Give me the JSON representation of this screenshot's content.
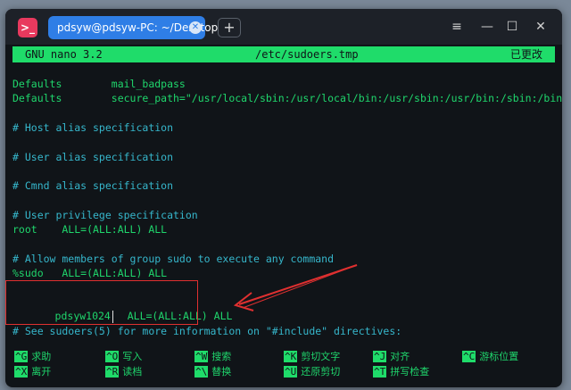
{
  "titlebar": {
    "tab_title": "pdsyw@pdsyw-PC: ~/Desktop",
    "tab_close": "✕",
    "new_tab": "+",
    "menu_icon": "≡",
    "minimize": "—",
    "maximize": "☐",
    "close": "✕"
  },
  "nano_header": {
    "version": "GNU nano 3.2",
    "filename": "/etc/sudoers.tmp",
    "status": "已更改"
  },
  "lines": [
    {
      "text": "Defaults        mail_badpass",
      "type": "normal"
    },
    {
      "text": "Defaults        secure_path=\"/usr/local/sbin:/usr/local/bin:/usr/sbin:/usr/bin:/sbin:/bin\"",
      "type": "normal"
    },
    {
      "text": "# Host alias specification",
      "type": "comment"
    },
    {
      "text": "# User alias specification",
      "type": "comment"
    },
    {
      "text": "# Cmnd alias specification",
      "type": "comment"
    },
    {
      "text": "# User privilege specification",
      "type": "comment"
    },
    {
      "text": "root    ALL=(ALL:ALL) ALL",
      "type": "normal"
    },
    {
      "text": "# Allow members of group sudo to execute any command",
      "type": "comment"
    },
    {
      "text": "%sudo   ALL=(ALL:ALL) ALL",
      "type": "normal"
    },
    {
      "text": "# See sudoers(5) for more information on \"#include\" directives:",
      "type": "comment"
    }
  ],
  "edited_line": {
    "user": "pdsyw1024",
    "rule": "ALL=(ALL:ALL) ALL"
  },
  "shortcuts": [
    {
      "key": "^G",
      "label": "求助"
    },
    {
      "key": "^O",
      "label": "写入"
    },
    {
      "key": "^W",
      "label": "搜索"
    },
    {
      "key": "^K",
      "label": "剪切文字"
    },
    {
      "key": "^J",
      "label": "对齐"
    },
    {
      "key": "^C",
      "label": "游标位置"
    },
    {
      "key": "^X",
      "label": "离开"
    },
    {
      "key": "^R",
      "label": "读档"
    },
    {
      "key": "^\\",
      "label": "替换"
    },
    {
      "key": "^U",
      "label": "还原剪切"
    },
    {
      "key": "^T",
      "label": "拼写检查"
    }
  ],
  "colors": {
    "text_green": "#1fd66c",
    "comment_cyan": "#36b7cc",
    "header_bg": "#1fdc6a",
    "tab_blue": "#2f7ee6",
    "highlight_red": "#e03030"
  }
}
